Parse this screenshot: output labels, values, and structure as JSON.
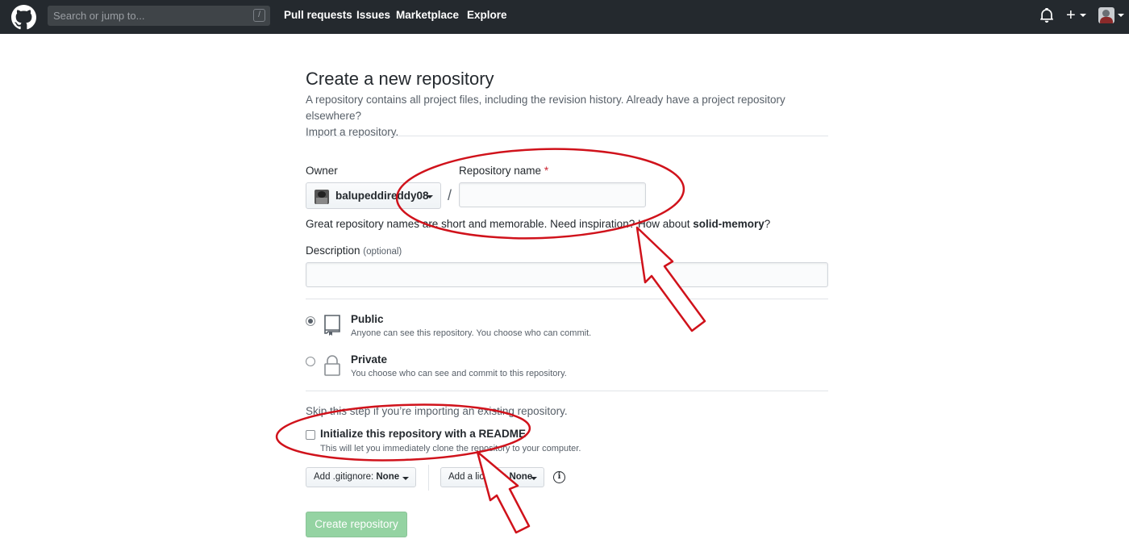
{
  "header": {
    "search_placeholder": "Search or jump to...",
    "search_shortcut": "/",
    "nav": [
      "Pull requests",
      "Issues",
      "Marketplace",
      "Explore"
    ],
    "plus_symbol": "+"
  },
  "main": {
    "title": "Create a new repository",
    "subtitle": "A repository contains all project files, including the revision history. Already have a project repository elsewhere?",
    "import_link": "Import a repository.",
    "owner_label": "Owner",
    "owner_value": "balupeddireddy08",
    "slash": "/",
    "repo_name_label": "Repository name",
    "required_mark": "*",
    "repo_name_value": "",
    "hint_text": "Great repository names are short and memorable. Need inspiration? How about ",
    "hint_suggestion": "solid-memory",
    "hint_end": "?",
    "description_label": "Description",
    "description_optional": "(optional)",
    "description_value": "",
    "visibility": {
      "public_title": "Public",
      "public_desc": "Anyone can see this repository. You choose who can commit.",
      "private_title": "Private",
      "private_desc": "You choose who can see and commit to this repository.",
      "selected": "Public"
    },
    "skip_text": "Skip this step if you’re importing an existing repository.",
    "init_label": "Initialize this repository with a README",
    "init_desc": "This will let you immediately clone the repository to your computer.",
    "init_checked": false,
    "gitignore_label": "Add .gitignore:",
    "gitignore_value": "None",
    "license_label": "Add a license:",
    "license_value": "None",
    "info_symbol": "i",
    "create_button": "Create repository"
  },
  "annotation_color": "#d0121b"
}
